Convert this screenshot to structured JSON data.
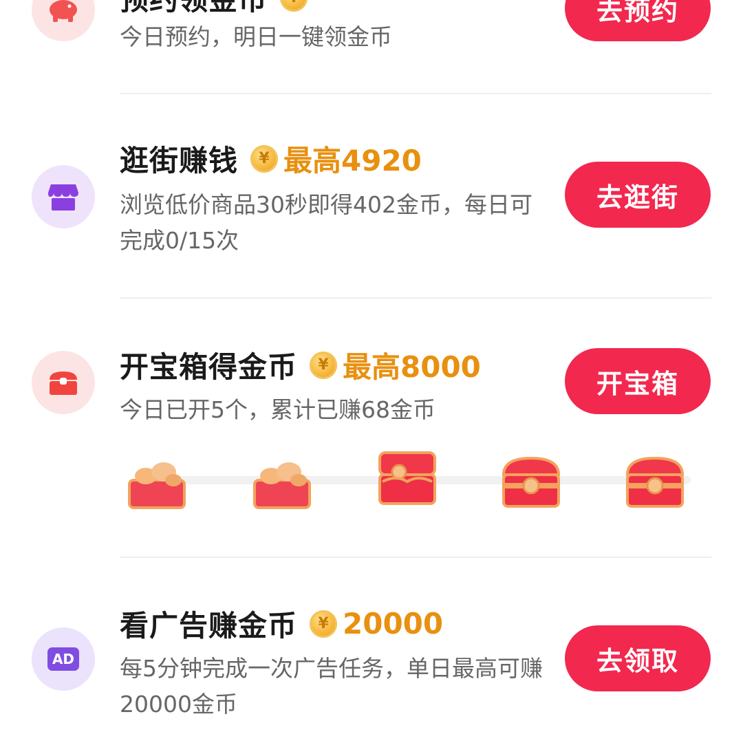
{
  "tasks": [
    {
      "title": "预约领金币",
      "desc": "今日预约，明日一键领金币",
      "button": "去预约",
      "icon": "piggy-bank-icon"
    },
    {
      "title": "逛街赚钱",
      "reward": "最高4920",
      "desc": "浏览低价商品30秒即得402金币，每日可完成0/15次",
      "button": "去逛街",
      "icon": "shop-icon"
    },
    {
      "title": "开宝箱得金币",
      "reward": "最高8000",
      "desc": "今日已开5个，累计已赚68金币",
      "button": "开宝箱",
      "icon": "treasure-chest-icon",
      "chests": [
        "opened",
        "opened",
        "opening",
        "closed",
        "closed"
      ]
    },
    {
      "title": "看广告赚金币",
      "reward": "20000",
      "desc": "每5分钟完成一次广告任务，单日最高可赚20000金币",
      "button": "去领取",
      "icon": "ad-icon",
      "icon_text": "AD"
    }
  ],
  "coin_symbol": "¥",
  "colors": {
    "button": "#f2284e",
    "reward": "#e8900f",
    "title": "#1a1a1a",
    "desc": "#666666"
  }
}
